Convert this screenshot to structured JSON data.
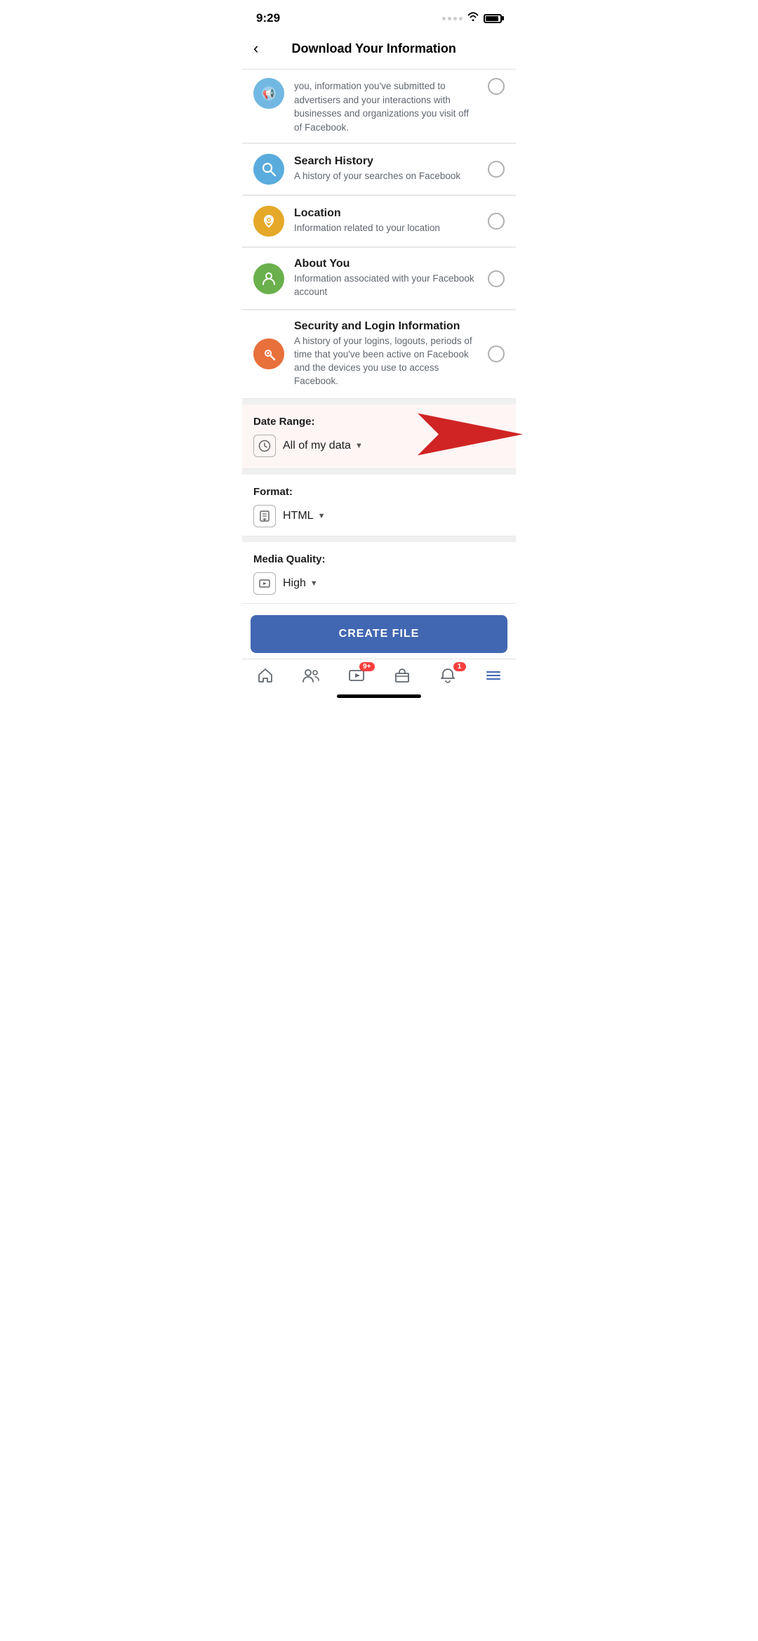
{
  "statusBar": {
    "time": "9:29"
  },
  "header": {
    "backLabel": "‹",
    "title": "Download Your Information"
  },
  "partialItem": {
    "description": "you, information you've submitted to advertisers and your interactions with businesses and organizations you visit off of Facebook."
  },
  "listItems": [
    {
      "id": "search-history",
      "iconType": "blue",
      "iconSymbol": "🔍",
      "title": "Search History",
      "description": "A history of your searches on Facebook",
      "checked": false
    },
    {
      "id": "location",
      "iconType": "yellow",
      "iconSymbol": "📍",
      "title": "Location",
      "description": "Information related to your location",
      "checked": false
    },
    {
      "id": "about-you",
      "iconType": "green",
      "iconSymbol": "👤",
      "title": "About You",
      "description": "Information associated with your Facebook account",
      "checked": false
    },
    {
      "id": "security-login",
      "iconType": "orange",
      "iconSymbol": "🔑",
      "title": "Security and Login Information",
      "description": "A history of your logins, logouts, periods of time that you've been active on Facebook and the devices you use to access Facebook.",
      "checked": false
    }
  ],
  "dateRange": {
    "label": "Date Range:",
    "value": "All of my data",
    "hasArrow": true
  },
  "format": {
    "label": "Format:",
    "value": "HTML"
  },
  "mediaQuality": {
    "label": "Media Quality:",
    "value": "High"
  },
  "createButton": {
    "label": "CREATE FILE"
  },
  "bottomNav": {
    "items": [
      {
        "id": "home",
        "icon": "home",
        "badge": null
      },
      {
        "id": "friends",
        "icon": "friends",
        "badge": null
      },
      {
        "id": "watch",
        "icon": "watch",
        "badge": "9+"
      },
      {
        "id": "marketplace",
        "icon": "marketplace",
        "badge": null
      },
      {
        "id": "notifications",
        "icon": "bell",
        "badge": "1"
      },
      {
        "id": "menu",
        "icon": "menu",
        "badge": null
      }
    ]
  }
}
